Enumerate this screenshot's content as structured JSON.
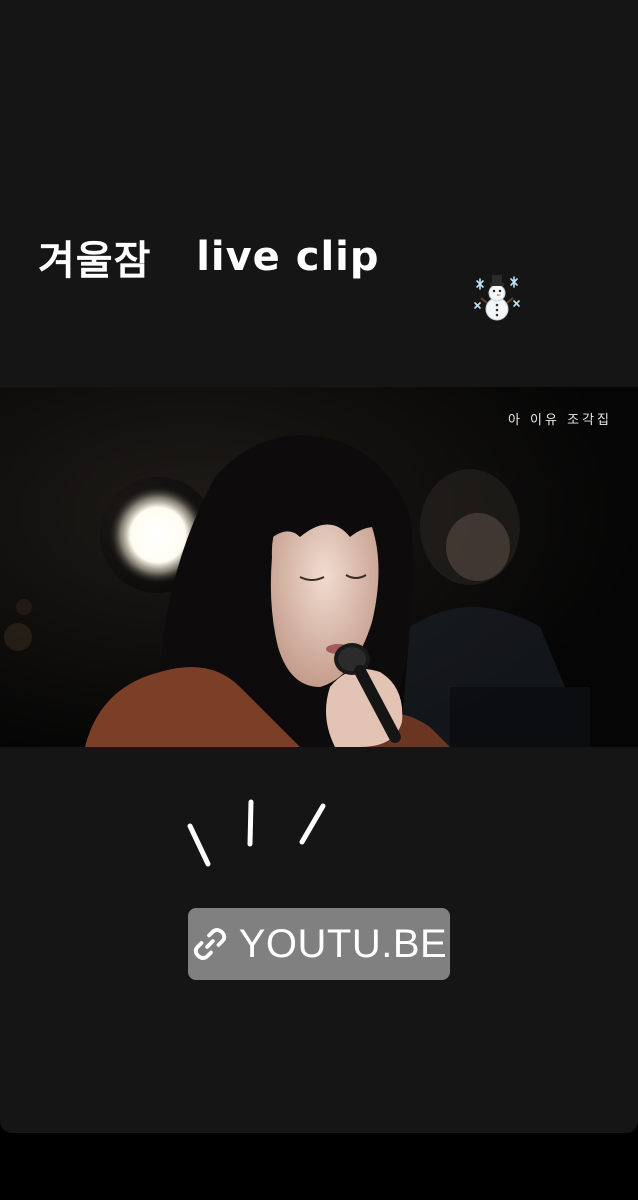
{
  "story": {
    "caption_korean": "겨울잠",
    "caption_latin": "live clip",
    "caption_emoji": "snowman-with-snowflakes-icon"
  },
  "video": {
    "watermark": "아 이유 조각집"
  },
  "link_sticker": {
    "icon": "link-icon",
    "label": "YOUTU.BE"
  },
  "colors": {
    "story_background": "#151515",
    "sticker_background": "#808080",
    "text": "#ffffff"
  }
}
